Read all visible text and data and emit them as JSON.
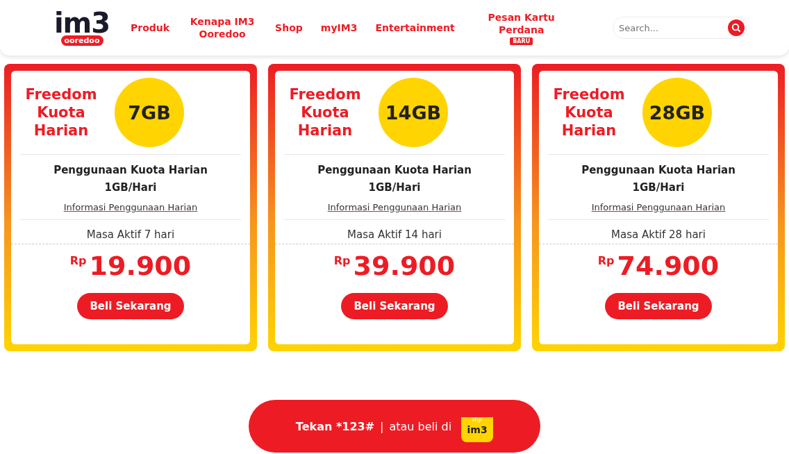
{
  "header": {
    "logo": {
      "main": "im3",
      "sub": "ooredoo"
    },
    "nav": [
      {
        "label": "Produk"
      },
      {
        "label": "Kenapa IM3 Ooredoo"
      },
      {
        "label": "Shop"
      },
      {
        "label": "myIM3"
      },
      {
        "label": "Entertainment"
      },
      {
        "label": "Pesan Kartu Perdana",
        "badge": "BARU"
      }
    ],
    "search": {
      "placeholder": "Search..."
    }
  },
  "cards": [
    {
      "title": "Freedom Kuota Harian",
      "quota": "7GB",
      "usage": "Penggunaan Kuota Harian 1GB/Hari",
      "info_link": "Informasi Penggunaan Harian",
      "validity": "Masa Aktif 7 hari",
      "currency": "Rp",
      "price": "19.900",
      "button": "Beli Sekarang"
    },
    {
      "title": "Freedom Kuota Harian",
      "quota": "14GB",
      "usage": "Penggunaan Kuota Harian 1GB/Hari",
      "info_link": "Informasi Penggunaan Harian",
      "validity": "Masa Aktif 14 hari",
      "currency": "Rp",
      "price": "39.900",
      "button": "Beli Sekarang"
    },
    {
      "title": "Freedom Kuota Harian",
      "quota": "28GB",
      "usage": "Penggunaan Kuota Harian 1GB/Hari",
      "info_link": "Informasi Penggunaan Harian",
      "validity": "Masa Aktif 28 hari",
      "currency": "Rp",
      "price": "74.900",
      "button": "Beli Sekarang"
    }
  ],
  "cta": {
    "code": "Tekan *123#",
    "separator": "|",
    "text": "atau beli di",
    "app_icon": {
      "top": "my",
      "main": "im3"
    }
  }
}
